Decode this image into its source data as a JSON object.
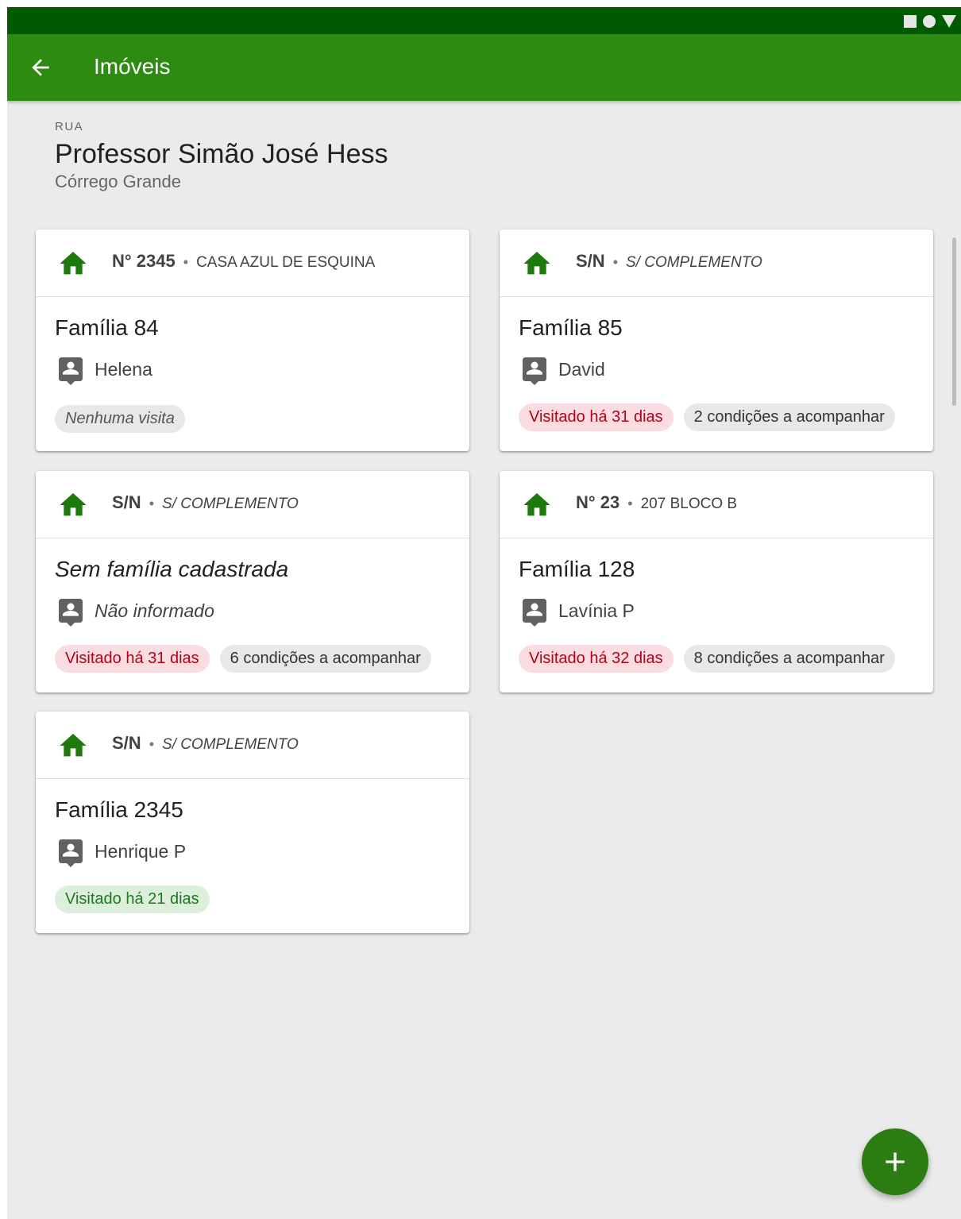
{
  "appbar": {
    "title": "Imóveis"
  },
  "header": {
    "type_label": "RUA",
    "street_name": "Professor Simão José Hess",
    "district": "Córrego Grande"
  },
  "cards": [
    {
      "number": "N° 2345",
      "complement": "CASA AZUL DE ESQUINA",
      "family": "Família 84",
      "person": "Helena",
      "visit_chip": "Nenhuma visita",
      "conditions_chip": ""
    },
    {
      "number": "S/N",
      "complement": "S/ COMPLEMENTO",
      "family": "Família 85",
      "person": "David",
      "visit_chip": "Visitado há 31 dias",
      "conditions_chip": "2 condições a acompanhar"
    },
    {
      "number": "S/N",
      "complement": "S/ COMPLEMENTO",
      "family": "Sem família cadastrada",
      "person": "Não informado",
      "visit_chip": "Visitado há 31 dias",
      "conditions_chip": "6 condições a acompanhar"
    },
    {
      "number": "N° 23",
      "complement": "207 BLOCO B",
      "family": "Família 128",
      "person": "Lavínia P",
      "visit_chip": "Visitado há 32 dias",
      "conditions_chip": "8 condições a acompanhar"
    },
    {
      "number": "S/N",
      "complement": "S/ COMPLEMENTO",
      "family": "Família 2345",
      "person": "Henrique P",
      "visit_chip": "Visitado há 21 dias",
      "conditions_chip": ""
    }
  ],
  "colors": {
    "primary": "#2e8b12",
    "status_bar": "#005a00",
    "house_icon": "#1f7a0d",
    "chip_overdue_text": "#b5001b",
    "chip_recent_text": "#1f7a1f"
  },
  "icons": {
    "back": "arrow-back-icon",
    "house": "home-icon",
    "person": "account-box-icon",
    "add": "plus-icon"
  }
}
